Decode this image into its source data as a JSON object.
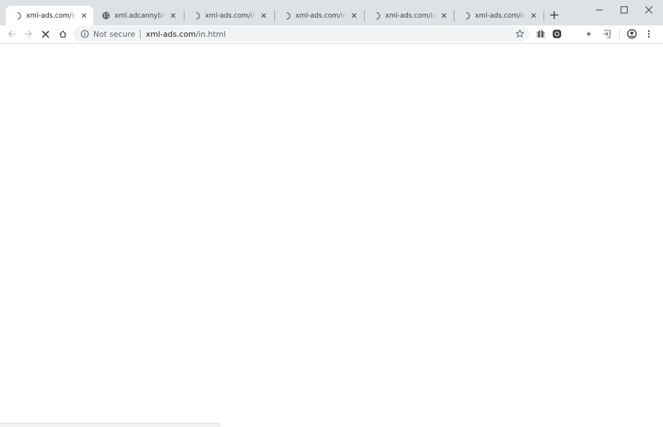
{
  "browser": {
    "tabs": [
      {
        "title": "xml-ads.com/in.html",
        "favicon": "loading-spinner-icon",
        "active": true
      },
      {
        "title": "xml.adcannybid.com",
        "favicon": "globe-icon",
        "active": false
      },
      {
        "title": "xml-ads.com/in.html",
        "favicon": "loading-spinner-icon",
        "active": false
      },
      {
        "title": "xml-ads.com/in.html",
        "favicon": "loading-spinner-icon",
        "active": false
      },
      {
        "title": "xml-ads.com/in.html",
        "favicon": "loading-spinner-icon",
        "active": false
      },
      {
        "title": "xml-ads.com/in.html",
        "favicon": "loading-spinner-icon",
        "active": false
      }
    ],
    "new_tab_label": "+",
    "window_controls": [
      "minimize-icon",
      "maximize-icon",
      "close-icon"
    ]
  },
  "toolbar": {
    "nav_icons": [
      "back-arrow-icon",
      "forward-arrow-icon",
      "stop-icon",
      "home-icon"
    ],
    "omnibox": {
      "security_label": "Not secure",
      "url_host": "xml-ads.com",
      "url_path": "/in.html"
    },
    "extension_icons": [
      "bookmark-star-icon",
      "extension-bug-icon",
      "extension-dark-circle-icon",
      "extension-small-icon",
      "extension-cast-icon",
      "profile-avatar-icon",
      "menu-kebab-icon"
    ]
  },
  "colors": {
    "tabstrip_bg": "#dee1e6",
    "omnibox_bg": "#f1f3f4",
    "text": "#202124",
    "muted": "#5f6368"
  }
}
